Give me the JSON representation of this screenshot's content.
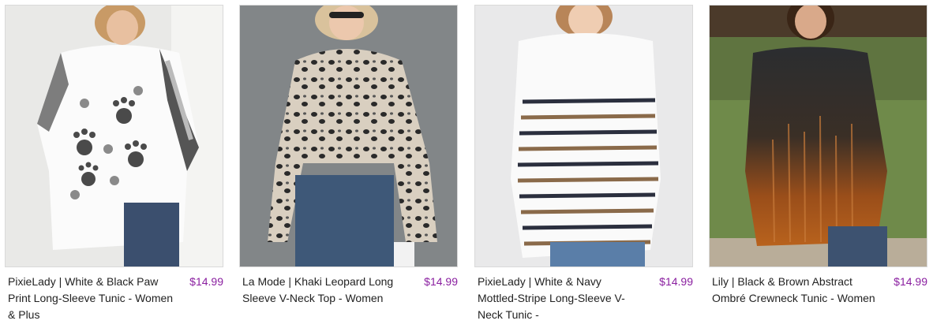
{
  "products": [
    {
      "title": "PixieLady | White & Black Paw Print Long-Sleeve Tunic - Women & Plus",
      "price": "$14.99",
      "image_icon": "paw-print-tunic-photo"
    },
    {
      "title": "La Mode | Khaki Leopard Long Sleeve V-Neck Top - Women",
      "price": "$14.99",
      "image_icon": "leopard-top-photo"
    },
    {
      "title": "PixieLady | White & Navy Mottled-Stripe Long-Sleeve V-Neck Tunic -",
      "price": "$14.99",
      "image_icon": "stripe-tunic-photo"
    },
    {
      "title": "Lily | Black & Brown Abstract Ombré Crewneck Tunic - Women",
      "price": "$14.99",
      "image_icon": "ombre-tunic-photo"
    }
  ],
  "colors": {
    "price": "#8a1fa0",
    "border": "#d9d9d9"
  }
}
